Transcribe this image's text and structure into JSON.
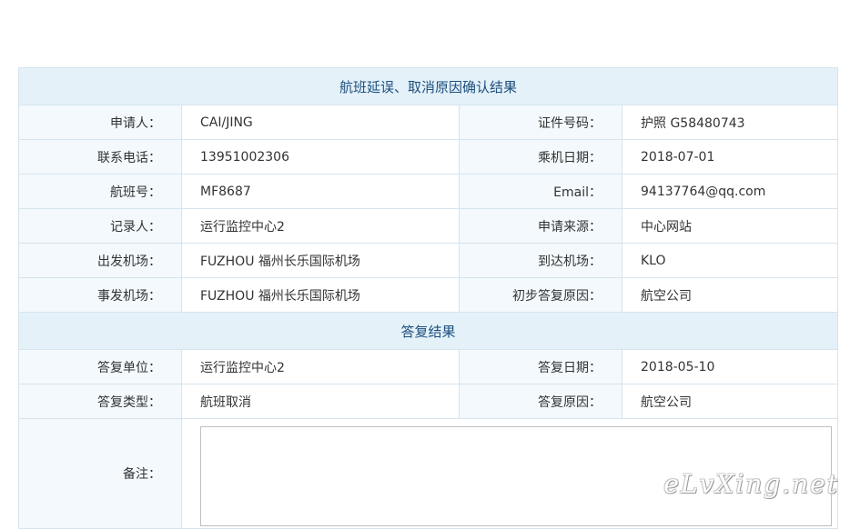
{
  "section1": {
    "title": "航班延误、取消原因确认结果"
  },
  "rows1": [
    {
      "l1": "申请人：",
      "v1": "CAI/JING",
      "l2": "证件号码：",
      "v2": "护照 G58480743"
    },
    {
      "l1": "联系电话：",
      "v1": "13951002306",
      "l2": "乘机日期：",
      "v2": "2018-07-01"
    },
    {
      "l1": "航班号：",
      "v1": "MF8687",
      "l2": "Email：",
      "v2": "94137764@qq.com"
    },
    {
      "l1": "记录人：",
      "v1": "运行监控中心2",
      "l2": "申请来源：",
      "v2": "中心网站"
    },
    {
      "l1": "出发机场：",
      "v1": "FUZHOU 福州长乐国际机场",
      "l2": "到达机场：",
      "v2": "KLO"
    },
    {
      "l1": "事发机场：",
      "v1": "FUZHOU 福州长乐国际机场",
      "l2": "初步答复原因：",
      "v2": "航空公司"
    }
  ],
  "section2": {
    "title": "答复结果"
  },
  "rows2": [
    {
      "l1": "答复单位：",
      "v1": "运行监控中心2",
      "l2": "答复日期：",
      "v2": "2018-05-10"
    },
    {
      "l1": "答复类型：",
      "v1": "航班取消",
      "l2": "答复原因：",
      "v2": "航空公司"
    }
  ],
  "remark": {
    "label": "备注：",
    "value": ""
  },
  "watermark": "eLvXing.net"
}
